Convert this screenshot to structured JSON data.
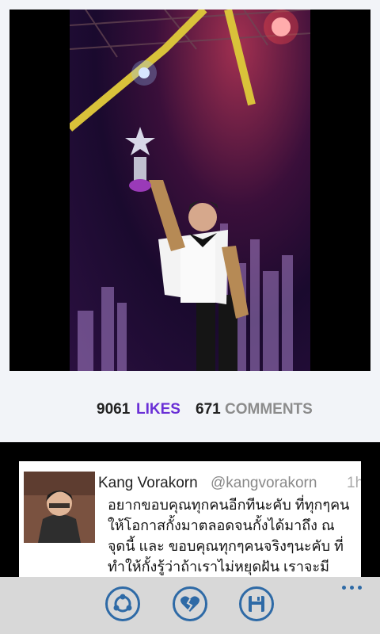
{
  "post": {
    "likes_count": "9061",
    "likes_label": "LIKES",
    "comments_count": "671",
    "comments_label": "COMMENTS"
  },
  "comment": {
    "author": "Kang Vorakorn",
    "handle": "@kangvorakorn",
    "time": "1h",
    "text": "อยากขอบคุณทุกคนอีกทีนะคับ ที่ทุกๆคนให้โอกาสกั้งมาตลอดจนกั้งได้มาถึง ณ จุดนี้ และ ขอบคุณทุกๆคนจริงๆนะคับ ที่ทำให้กั้งรู้ว่าถ้าเราไม่หยุดฝัน เราจะมีโอกาสไป"
  },
  "app_bar": {
    "buttons": [
      {
        "icon": "share-icon"
      },
      {
        "icon": "broken-heart-icon"
      },
      {
        "icon": "save-icon"
      }
    ],
    "more_icon": "more-icon"
  },
  "colors": {
    "accent": "#6a2fd6",
    "app_bar_icon": "#2e6aa6",
    "panel_background": "#f2f4f8",
    "app_bar_background": "#d8d8d8"
  }
}
